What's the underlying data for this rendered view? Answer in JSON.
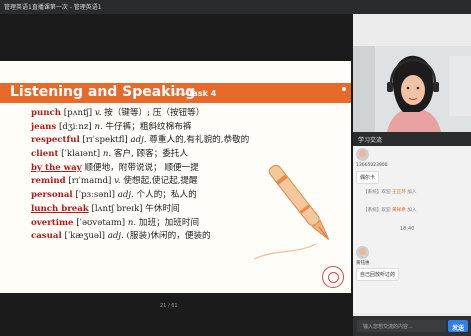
{
  "window": {
    "title": "管理英语1直播课第一次 - 管理英语1"
  },
  "slide": {
    "heading": "Listening and Speaking",
    "task": "——Task 4",
    "page": "21 / 61",
    "rows": [
      {
        "word": "punch",
        "phon": " [pʌntʃ] ",
        "pos": "v. ",
        "def": "按（键等）; 压（按钮等）",
        "underline": false
      },
      {
        "word": "jeans",
        "phon": " [dʒiːnz] ",
        "pos": "n. ",
        "def": "牛仔裤；粗斜纹棉布裤",
        "underline": false
      },
      {
        "word": "respectful",
        "phon": " [rɪˈspektfl] ",
        "pos": "adj. ",
        "def": "尊重人的,有礼貌的,恭敬的",
        "underline": false
      },
      {
        "word": "client",
        "phon": " [ˈklaɪənt] ",
        "pos": "n. ",
        "def": "客户, 顾客；委托人",
        "underline": false
      },
      {
        "word": "by the way",
        "phon": " ",
        "pos": "",
        "def": "顺便地，附带说说； 顺便一提",
        "underline": true
      },
      {
        "word": "remind",
        "phon": " [rɪˈmaɪnd] ",
        "pos": "v. ",
        "def": "使想起,使记起,提醒",
        "underline": false
      },
      {
        "word": "personal",
        "phon": " [ˈpɜːsənl] ",
        "pos": "adj. ",
        "def": "个人的；私人的",
        "underline": false
      },
      {
        "word": "lunch break",
        "phon": " [lʌntʃ breɪk] ",
        "pos": "",
        "def": "午休时间",
        "underline": true
      },
      {
        "word": "overtime",
        "phon": " [ˈəʊvətaɪm] ",
        "pos": "n. ",
        "def": "加班；加班时间",
        "underline": false
      },
      {
        "word": "casual",
        "phon": " [ˈkæʒuəl] ",
        "pos": "adj. ",
        "def": "(服装)休闲的，便装的",
        "underline": false
      }
    ]
  },
  "chat": {
    "header": "学习交流",
    "msg1": {
      "user": "13665023900",
      "text": "偶尔卡"
    },
    "notice1": {
      "prefix": "【系统】欢迎 ",
      "name": "王正环",
      "suffix": " 加入"
    },
    "notice2": {
      "prefix": "【系统】欢迎 ",
      "name": "黄祥希",
      "suffix": " 加入"
    },
    "time": "18:40",
    "msg2": {
      "user": "黄钰惠",
      "text": "自己回放听过的"
    },
    "input_placeholder": "输入您想交流的内容...",
    "send": "发送"
  },
  "colors": {
    "banner": "#e76a2b",
    "word": "#b21b1b",
    "send": "#2f80ed"
  }
}
